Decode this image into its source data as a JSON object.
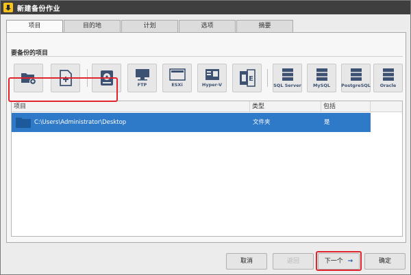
{
  "window": {
    "title": "新建备份作业"
  },
  "tabs": [
    {
      "label": "项目"
    },
    {
      "label": "目的地"
    },
    {
      "label": "计划"
    },
    {
      "label": "选项"
    },
    {
      "label": "摘要"
    }
  ],
  "section": {
    "label": "要备份的项目"
  },
  "toolbar": {
    "items": [
      {
        "icon": "add-folder-icon",
        "label": ""
      },
      {
        "icon": "add-file-icon",
        "label": ""
      },
      {
        "icon": "disk-icon",
        "label": ""
      },
      {
        "icon": "ftp-icon",
        "label": "FTP"
      },
      {
        "icon": "esxi-icon",
        "label": "ESXi"
      },
      {
        "icon": "hyper-v-icon",
        "label": "Hyper-V"
      },
      {
        "icon": "exchange-icon",
        "label": "E"
      },
      {
        "icon": "sql-server-icon",
        "label": "SQL Server"
      },
      {
        "icon": "mysql-icon",
        "label": "MySQL"
      },
      {
        "icon": "postgresql-icon",
        "label": "PostgreSQL"
      },
      {
        "icon": "oracle-icon",
        "label": "Oracle"
      }
    ]
  },
  "list": {
    "columns": [
      "项目",
      "类型",
      "包括"
    ],
    "rows": [
      {
        "path": "C:\\Users\\Administrator\\Desktop",
        "type": "文件夹",
        "include": "是",
        "selected": true
      }
    ]
  },
  "buttons": {
    "cancel": "取消",
    "back": "返回",
    "next": "下一个",
    "next_arrow": "→",
    "ok": "确定"
  },
  "colors": {
    "titlebar": "#3f3f3f",
    "selection": "#2f79c9",
    "highlight": "#e0232b",
    "toolbar_icon": "#3d5272"
  }
}
